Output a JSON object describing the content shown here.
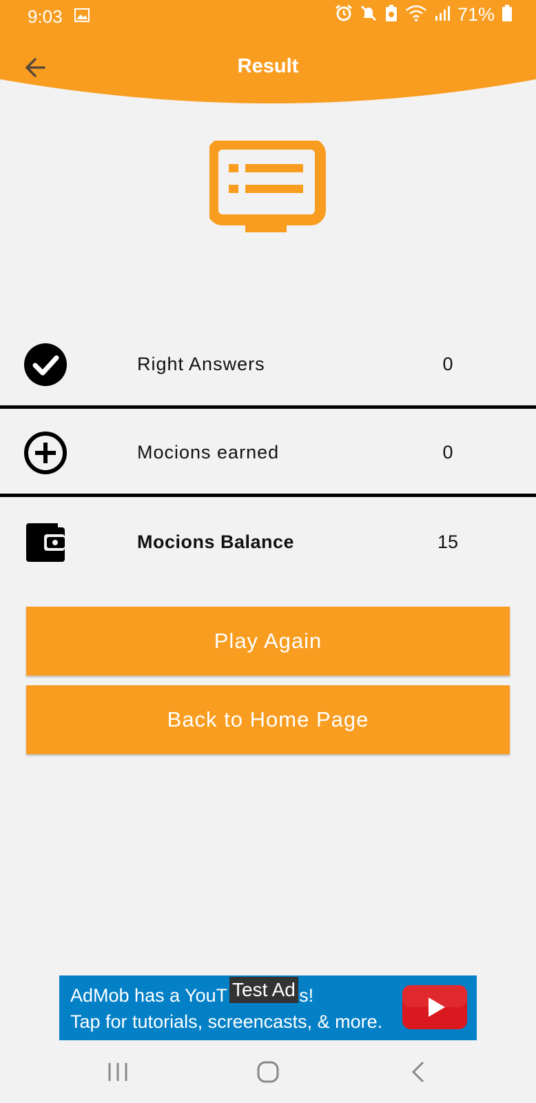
{
  "status_bar": {
    "time": "9:03",
    "battery": "71%",
    "icons": [
      "image-icon",
      "alarm-icon",
      "mute-icon",
      "battery-saver-icon",
      "wifi-icon",
      "signal-icon",
      "battery-icon"
    ]
  },
  "toolbar": {
    "title": "Result",
    "back_icon": "arrow-left-icon"
  },
  "hero": {
    "icon": "result-list-monitor-icon"
  },
  "results": [
    {
      "icon": "check-circle-icon",
      "label": "Right Answers",
      "value": "0"
    },
    {
      "icon": "plus-circle-icon",
      "label": "Mocions earned",
      "value": "0"
    },
    {
      "icon": "wallet-icon",
      "label": "Mocions Balance",
      "value": "15"
    }
  ],
  "buttons": {
    "play_again": "Play Again",
    "back_home": "Back to Home Page"
  },
  "ad": {
    "line1_start": "AdMob has a YouT",
    "line1_end": "s!",
    "badge": "Test Ad",
    "line2": "Tap for tutorials, screencasts, & more.",
    "icon": "youtube-play-icon"
  },
  "nav": {
    "icons": [
      "recent-apps-icon",
      "home-icon",
      "back-icon"
    ]
  },
  "colors": {
    "accent": "#f99d20",
    "background": "#f2f2f2",
    "ad_background": "#0480c6"
  }
}
